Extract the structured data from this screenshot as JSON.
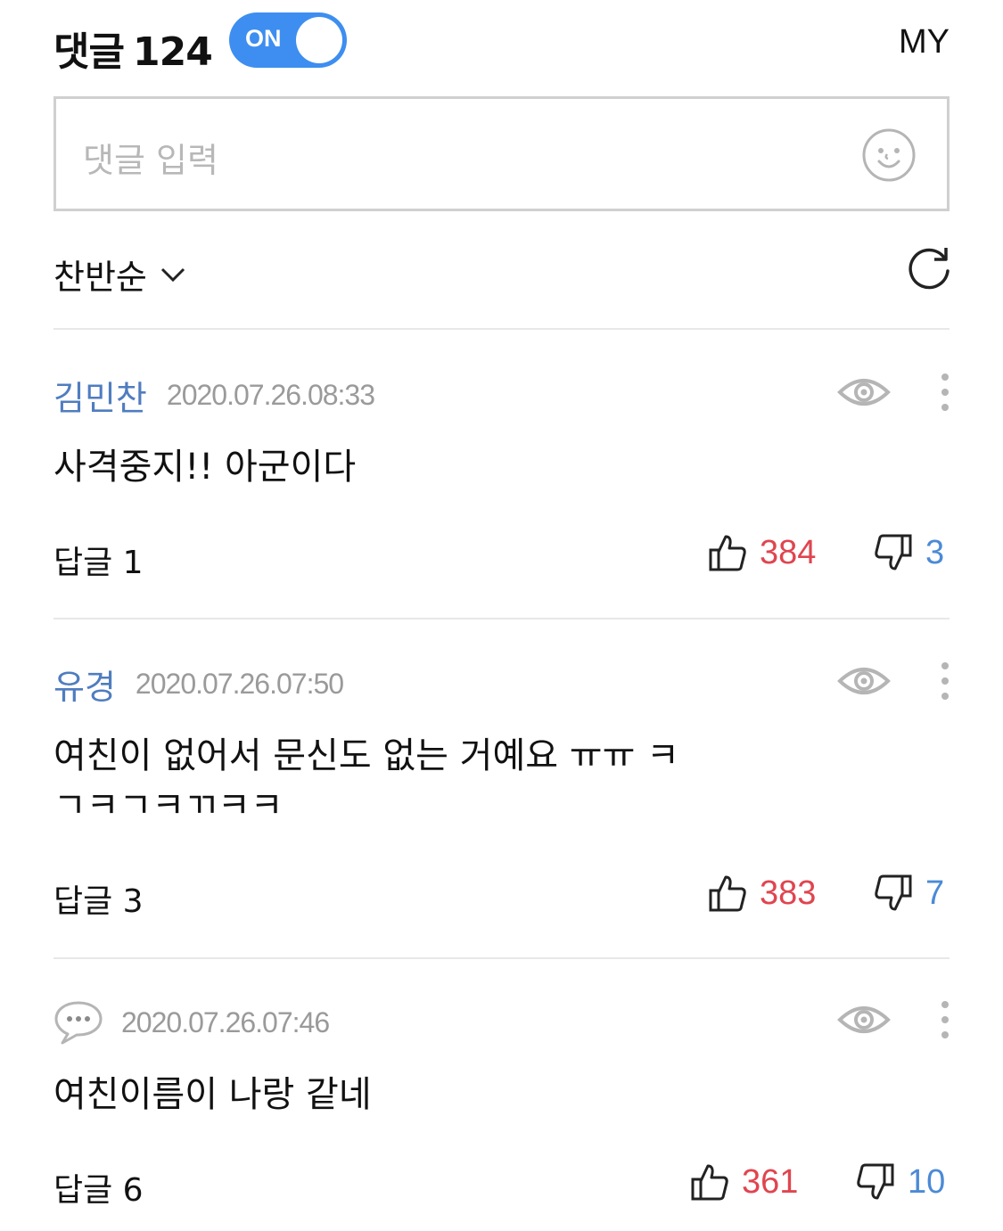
{
  "header": {
    "title": "댓글",
    "count": "124",
    "toggle_label": "ON",
    "my_label": "MY"
  },
  "input": {
    "placeholder": "댓글 입력",
    "emoji_icon": "smiley-face-icon"
  },
  "sort": {
    "label": "찬반순",
    "icon": "chevron-down-icon",
    "refresh_icon": "refresh-icon"
  },
  "colors": {
    "accent": "#3d8ef0",
    "author": "#4f7dbf",
    "like": "#e0454f",
    "dislike": "#4b8ad6",
    "muted": "#9a9a9a"
  },
  "comments": [
    {
      "author": "김민찬",
      "date": "2020.07.26.08:33",
      "text": "사격중지!! 아군이다",
      "reply": "답글 1",
      "likes": "384",
      "dislikes": "3"
    },
    {
      "author": "유경",
      "date": "2020.07.26.07:50",
      "text": "여친이 없어서 문신도 없는 거예요 ㅠㅠ ㅋㄱㅋㄱㅋㄲㅋㅋ",
      "reply": "답글 3",
      "likes": "383",
      "dislikes": "7"
    },
    {
      "author": "",
      "date": "2020.07.26.07:46",
      "text": "여친이름이 나랑 같네",
      "reply": "답글 6",
      "likes": "361",
      "dislikes": "10"
    }
  ]
}
